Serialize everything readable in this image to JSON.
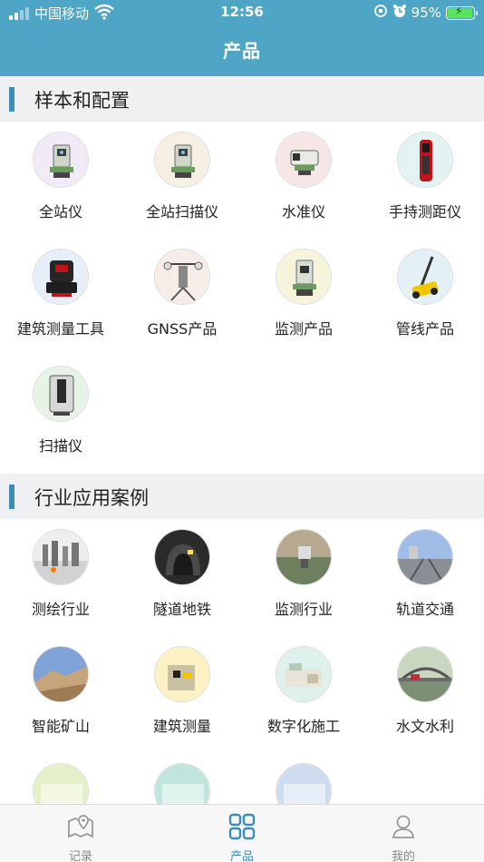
{
  "status_bar": {
    "carrier": "中国移动",
    "time": "12:56",
    "battery": "95%",
    "battery_level": 0.95
  },
  "header": {
    "title": "产品"
  },
  "sections": [
    {
      "title": "样本和配置",
      "items": [
        {
          "label": "全站仪",
          "icon": "total-station-icon",
          "bg": "#f2eaf6"
        },
        {
          "label": "全站扫描仪",
          "icon": "scanning-total-station-icon",
          "bg": "#f6efe4"
        },
        {
          "label": "水准仪",
          "icon": "level-instrument-icon",
          "bg": "#f7e6e6"
        },
        {
          "label": "手持测距仪",
          "icon": "laser-distance-meter-icon",
          "bg": "#e3f2f2"
        },
        {
          "label": "建筑测量工具",
          "icon": "construction-tool-icon",
          "bg": "#e6eef8"
        },
        {
          "label": "GNSS产品",
          "icon": "gnss-antenna-icon",
          "bg": "#f6ece8"
        },
        {
          "label": "监测产品",
          "icon": "monitoring-station-icon",
          "bg": "#f6f5dc"
        },
        {
          "label": "管线产品",
          "icon": "pipe-locator-icon",
          "bg": "#e3f0f6"
        },
        {
          "label": "扫描仪",
          "icon": "laser-scanner-icon",
          "bg": "#e6f3e6"
        }
      ]
    },
    {
      "title": "行业应用案例",
      "items": [
        {
          "label": "测绘行业",
          "icon": "surveying-photo-icon",
          "bg": "#eeeeee"
        },
        {
          "label": "隧道地铁",
          "icon": "tunnel-photo-icon",
          "bg": "#d9d9d9"
        },
        {
          "label": "监测行业",
          "icon": "monitoring-photo-icon",
          "bg": "#e4d8cc"
        },
        {
          "label": "轨道交通",
          "icon": "railway-photo-icon",
          "bg": "#d6e4f6"
        },
        {
          "label": "智能矿山",
          "icon": "mine-photo-icon",
          "bg": "#7fa3d6"
        },
        {
          "label": "建筑测量",
          "icon": "building-photo-icon",
          "bg": "#fbf1c2"
        },
        {
          "label": "数字化施工",
          "icon": "digital-construction-photo-icon",
          "bg": "#dff1ec"
        },
        {
          "label": "水文水利",
          "icon": "bridge-photo-icon",
          "bg": "#d9e7d0"
        },
        {
          "label": "",
          "icon": "partial-photo-icon",
          "bg": "#e4f0c8"
        },
        {
          "label": "",
          "icon": "partial-photo-icon",
          "bg": "#bfe5dc"
        },
        {
          "label": "",
          "icon": "partial-photo-icon",
          "bg": "#cfdcef"
        }
      ]
    }
  ],
  "tabbar": {
    "tabs": [
      {
        "label": "记录",
        "icon": "map-pin-icon",
        "active": false
      },
      {
        "label": "产品",
        "icon": "grid-icon",
        "active": true
      },
      {
        "label": "我的",
        "icon": "user-icon",
        "active": false
      }
    ]
  },
  "colors": {
    "header": "#4fa5c6",
    "accent": "#3d8eb4",
    "section_bg": "#eef0f1"
  }
}
